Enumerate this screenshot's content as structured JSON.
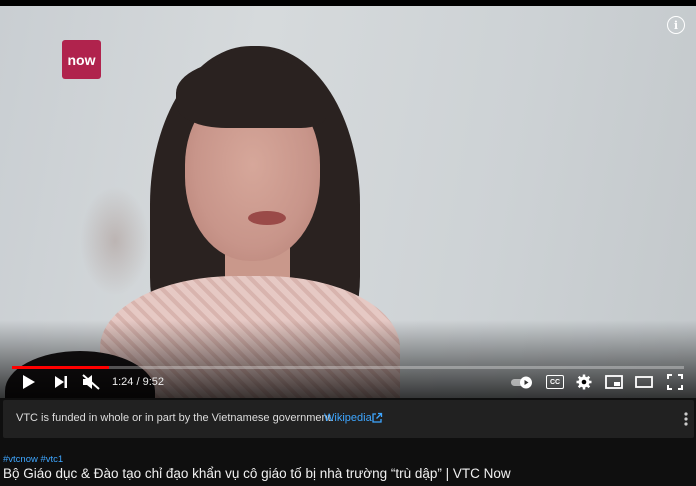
{
  "player": {
    "logo_text": "now",
    "info_icon": "info-icon",
    "progress": 0.145,
    "time_display": "1:24 / 9:52",
    "cc_label": "CC",
    "colors": {
      "progress": "#ff0000",
      "logo": "#b0234d"
    },
    "icons": [
      "play-icon",
      "next-icon",
      "mute-icon",
      "autoplay-toggle-icon",
      "cc-icon",
      "settings-icon",
      "miniplayer-icon",
      "theater-icon",
      "fullscreen-icon"
    ]
  },
  "funding": {
    "text": "VTC is funded in whole or in part by the Vietnamese government.",
    "link": "Wikipedia"
  },
  "video": {
    "hashtags": "#vtcnow #vtc1",
    "title": "Bộ Giáo dục & Đào tạo chỉ đạo khẩn vụ cô giáo tố bị nhà trường “trù dập” | VTC Now"
  }
}
